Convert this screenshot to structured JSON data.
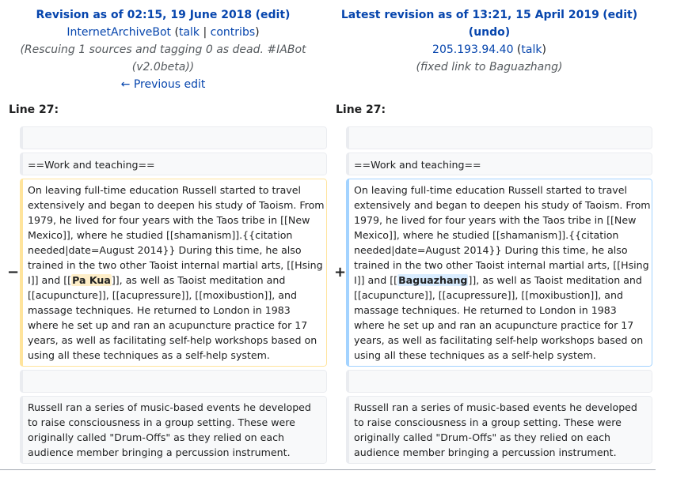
{
  "left_header": {
    "revision_prefix": "Revision as of 02:15, 19 June 2018",
    "edit_label": "edit",
    "user": "InternetArchiveBot",
    "talk": "talk",
    "contribs": "contribs",
    "summary_line1": "(Rescuing 1 sources and tagging 0 as dead. #IABot",
    "summary_line2": "(v2.0beta))",
    "prev_edit": "← Previous edit"
  },
  "right_header": {
    "revision_prefix": "Latest revision as of 13:21, 15 April 2019",
    "edit_label": "edit",
    "undo_label": "undo",
    "user": "205.193.94.40",
    "talk": "talk",
    "summary": "(fixed link to Baguazhang)"
  },
  "line_label": "Line 27:",
  "markers": {
    "minus": "−",
    "plus": "+"
  },
  "heading_text": "==Work and teaching==",
  "left_para": {
    "lines": [
      "On leaving full-time education Russell started to travel",
      "extensively and began to deepen his study of Taoism. From",
      "1979, he lived for four years with the Taos tribe in [[New",
      "Mexico]], where he studied [[shamanism]].{{citation",
      "needed|date=August 2014}} During this time, he also",
      "trained in the two other Taoist internal martial arts, [[Hsing"
    ],
    "line7_before": "I]] and [[",
    "line7_changed": "Pa Kua",
    "line7_after": "]], as well as Taoist meditation and",
    "rest": [
      "[[acupuncture]], [[acupressure]], [[moxibustion]], and",
      "massage techniques. He returned to London in 1983",
      "where he set up and ran an acupuncture practice for 17",
      "years, as well as facilitating self-help workshops based on",
      "using all these techniques as a self-help system."
    ]
  },
  "right_para": {
    "line7_changed": "Baguazhang"
  },
  "context_para": [
    "Russell ran a series of music-based events he developed",
    "to raise consciousness in a group setting. These were",
    "originally called \"Drum-Offs\" as they relied on each",
    "audience member bringing a percussion instrument."
  ],
  "colors": {
    "deleted_border": "#ffe49c",
    "added_border": "#a3d3ff",
    "link": "#0645ad"
  }
}
